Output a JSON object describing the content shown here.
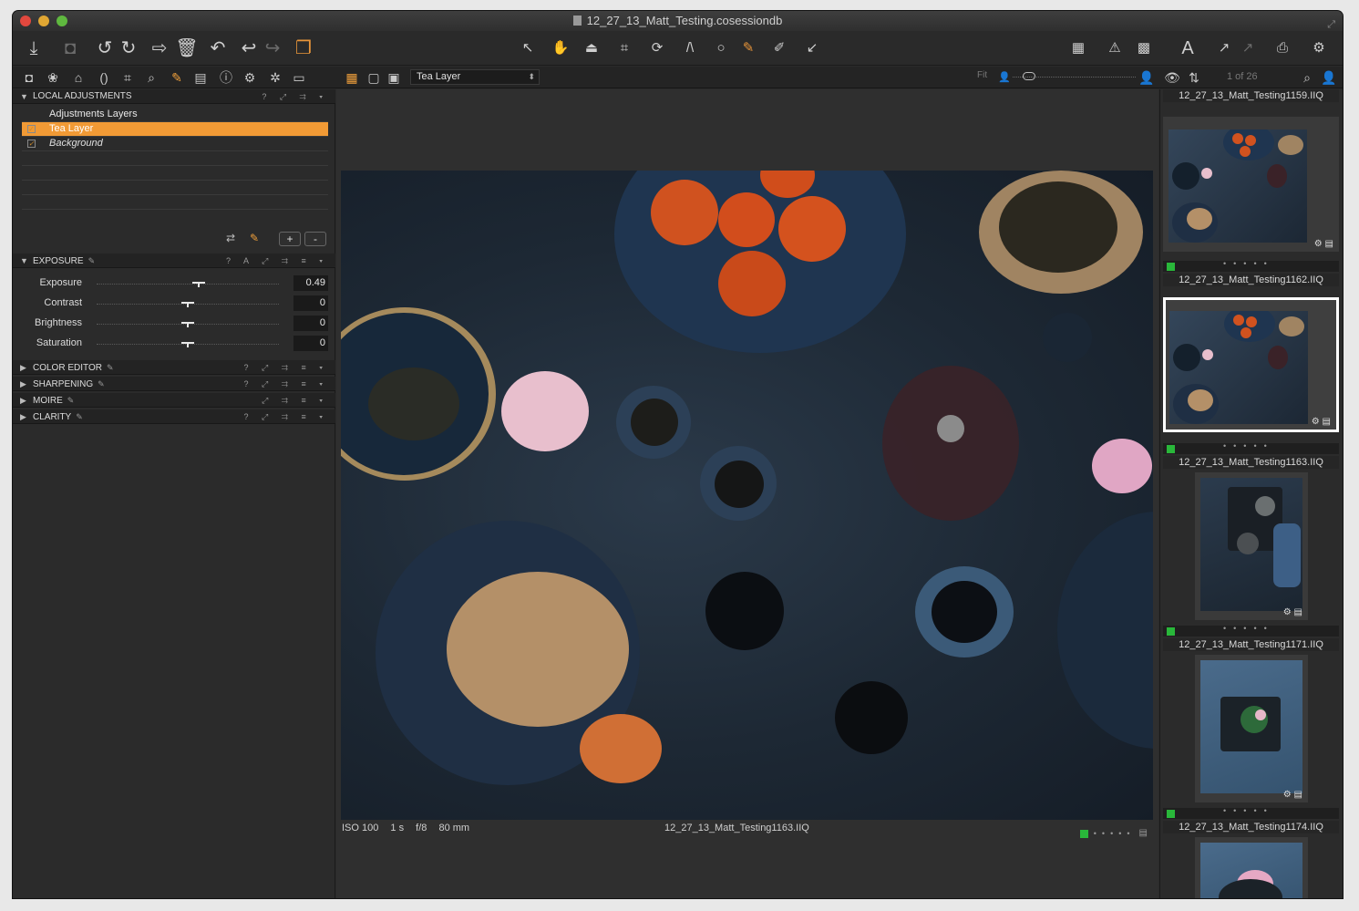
{
  "window": {
    "title": "12_27_13_Matt_Testing.cosessiondb"
  },
  "toolbar": {
    "left_icons": [
      "import-icon",
      "camera-icon",
      "rotate-left-icon",
      "rotate-right-icon",
      "move-to-icon",
      "delete-icon",
      "reset-icon",
      "undo-icon",
      "redo-icon",
      "variants-icon"
    ],
    "center_icons": [
      "select-cursor-icon",
      "pan-hand-icon",
      "loupe-icon",
      "crop-icon",
      "rotate-icon",
      "keystone-icon",
      "spot-removal-icon",
      "brush-icon",
      "color-picker-icon",
      "copy-apply-icon"
    ],
    "right_icons": [
      "grid-overlay-icon",
      "warning-icon",
      "focus-mask-icon",
      "text-icon",
      "export-icon",
      "copy-icon",
      "print-icon",
      "settings-icon"
    ]
  },
  "tabrow": {
    "tool_tabs": [
      "camera-icon",
      "color-icon",
      "exposure-icon",
      "lens-icon",
      "crop-icon",
      "focus-icon",
      "local-adjustments-icon",
      "metadata-icon",
      "info-icon",
      "settings-icon",
      "batch-icon",
      "library-icon"
    ],
    "layer_select": "Tea Layer",
    "fit_label": "Fit",
    "image_count": "1 of 26"
  },
  "local_adjustments": {
    "title": "LOCAL ADJUSTMENTS",
    "layers_header": "Adjustments Layers",
    "layers": [
      {
        "name": "Tea Layer",
        "selected": true
      },
      {
        "name": "Background",
        "selected": false
      }
    ]
  },
  "exposure": {
    "title": "EXPOSURE",
    "sliders": [
      {
        "label": "Exposure",
        "value": "0.49",
        "position": 0.56
      },
      {
        "label": "Contrast",
        "value": "0",
        "position": 0.5
      },
      {
        "label": "Brightness",
        "value": "0",
        "position": 0.5
      },
      {
        "label": "Saturation",
        "value": "0",
        "position": 0.5
      }
    ]
  },
  "collapsed_sections": [
    {
      "title": "COLOR EDITOR"
    },
    {
      "title": "SHARPENING"
    },
    {
      "title": "MOIRE"
    },
    {
      "title": "CLARITY"
    }
  ],
  "viewer": {
    "meta": {
      "iso": "ISO 100",
      "shutter": "1 s",
      "aperture": "f/8",
      "focal": "80 mm"
    },
    "filename": "12_27_13_Matt_Testing1163.IIQ"
  },
  "browser": {
    "thumbnails": [
      {
        "name": "12_27_13_Matt_Testing1162.IIQ",
        "selected": false
      },
      {
        "name": "12_27_13_Matt_Testing1163.IIQ",
        "selected": true
      },
      {
        "name": "12_27_13_Matt_Testing1171.IIQ",
        "selected": false
      },
      {
        "name": "12_27_13_Matt_Testing1174.IIQ",
        "selected": false
      }
    ]
  },
  "colors": {
    "accent": "#f19a35",
    "green_tag": "#29b73a",
    "background": "#2b2b2b"
  }
}
